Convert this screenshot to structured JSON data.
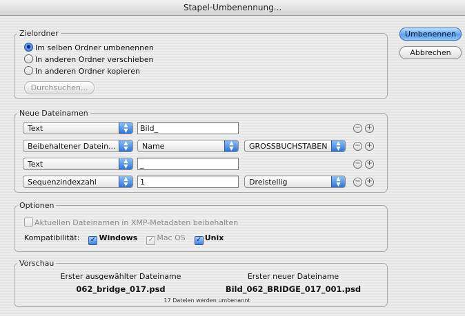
{
  "window": {
    "title": "Stapel-Umbenennung..."
  },
  "buttons": {
    "rename": "Umbenennen",
    "cancel": "Abbrechen",
    "browse": "Durchsuchen..."
  },
  "destination": {
    "legend": "Zielordner",
    "options": [
      {
        "label": "Im selben Ordner umbenennen",
        "selected": true
      },
      {
        "label": "In anderen Ordner verschieben",
        "selected": false
      },
      {
        "label": "In anderen Ordner kopieren",
        "selected": false
      }
    ]
  },
  "new_names": {
    "legend": "Neue Dateinamen",
    "rows": [
      {
        "type": "Text",
        "text_value": "Bild_"
      },
      {
        "type": "Beibehaltener Datein...",
        "subtype": "Name",
        "case": "GROSSBUCHSTABEN"
      },
      {
        "type": "Text",
        "text_value": "_"
      },
      {
        "type": "Sequenzindexzahl",
        "text_value": "1",
        "digits": "Dreistellig"
      }
    ],
    "remove_icon": "minus-circle-icon",
    "add_icon": "plus-circle-icon"
  },
  "options": {
    "legend": "Optionen",
    "keep_xmp": {
      "label": "Aktuellen Dateinamen in XMP-Metadaten beibehalten",
      "checked": false,
      "enabled": false
    },
    "compat_label": "Kompatibilität:",
    "compat": [
      {
        "label": "Windows",
        "checked": true,
        "enabled": true
      },
      {
        "label": "Mac OS",
        "checked": true,
        "enabled": false
      },
      {
        "label": "Unix",
        "checked": true,
        "enabled": true
      }
    ]
  },
  "preview": {
    "legend": "Vorschau",
    "first_selected_label": "Erster ausgewählter Dateiname",
    "first_selected_value": "062_bridge_017.psd",
    "first_new_label": "Erster neuer Dateiname",
    "first_new_value": "Bild_062_BRIDGE_017_001.psd",
    "count_text": "17 Dateien werden umbenannt"
  },
  "accent_color": "#3d7fd6"
}
